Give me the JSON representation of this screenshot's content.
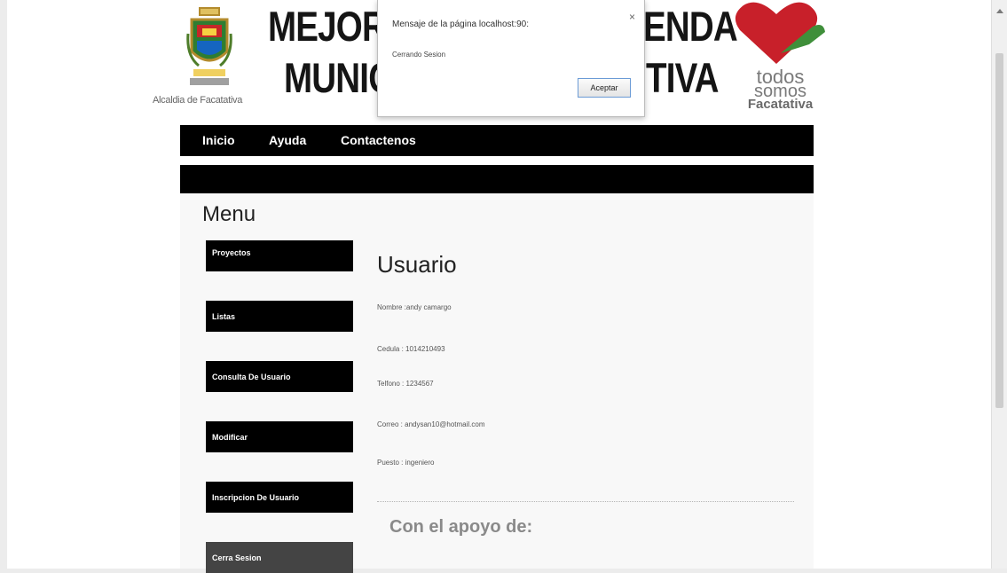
{
  "header": {
    "crest_caption": "Alcaldia de Facatativa",
    "banner_line1_left": "MEJOR",
    "banner_line2_left": "MUNIC",
    "banner_line1_right": "ENDA",
    "banner_line2_right": "TIVA",
    "logo_todos": "todos",
    "logo_somos": "somos",
    "logo_city": "Facatativa"
  },
  "dialog": {
    "title": "Mensaje de la página localhost:90:",
    "message": "Cerrando Sesion",
    "ok_label": "Aceptar",
    "close_glyph": "×"
  },
  "nav": {
    "items": [
      {
        "label": "Inicio"
      },
      {
        "label": "Ayuda"
      },
      {
        "label": "Contactenos"
      }
    ]
  },
  "menu": {
    "title": "Menu",
    "items": [
      {
        "label": "Proyectos"
      },
      {
        "label": "Listas"
      },
      {
        "label": "Consulta De Usuario"
      },
      {
        "label": "Modificar"
      },
      {
        "label": "Inscripcion De Usuario"
      },
      {
        "label": "Cerra Sesion"
      }
    ]
  },
  "user": {
    "title": "Usuario",
    "nombre": "Nombre :andy camargo",
    "cedula": "Cedula : 1014210493",
    "telefono": "Telfono : 1234567",
    "correo": "Correo : andysan10@hotmail.com",
    "puesto": "Puesto : ingeniero"
  },
  "footer": {
    "support": "Con el apoyo de:"
  },
  "colors": {
    "bar": "#000000",
    "heart_red": "#c8202a",
    "logo_gray": "#7a7a7a"
  }
}
